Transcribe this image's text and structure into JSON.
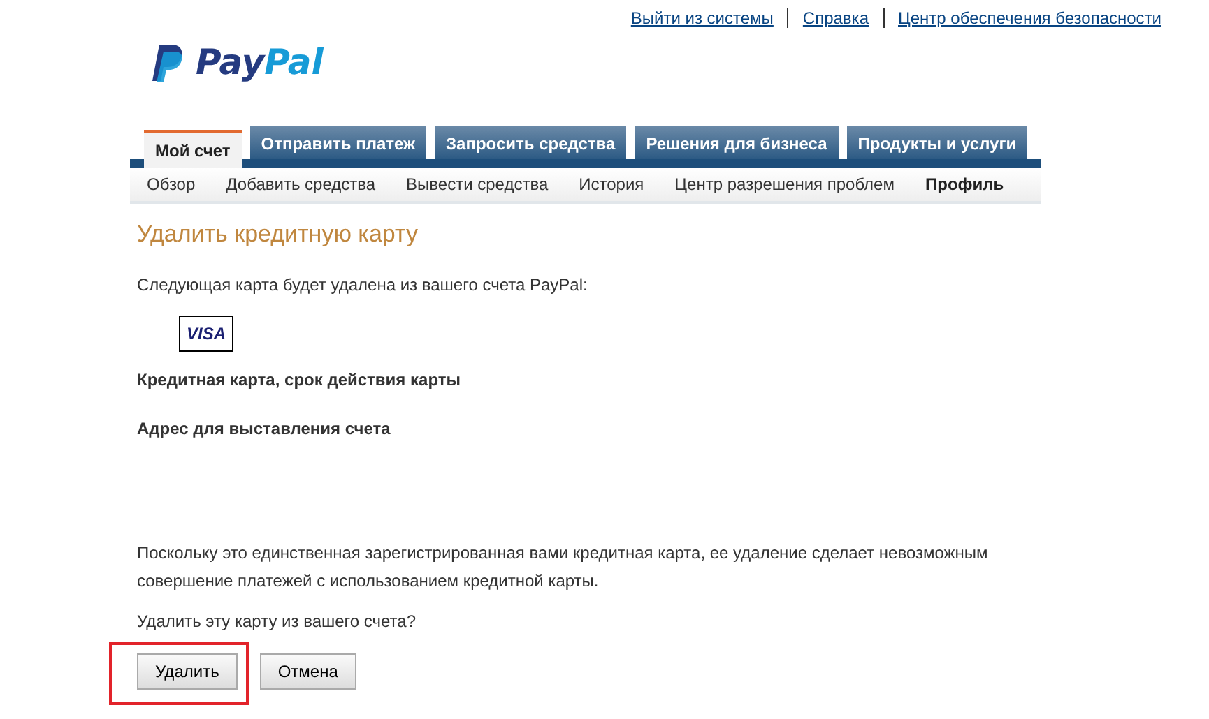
{
  "top_links": [
    {
      "label": "Выйти из системы"
    },
    {
      "label": "Справка"
    },
    {
      "label": "Центр обеспечения безопасности"
    }
  ],
  "logo": {
    "dark": "Pay",
    "light": "Pal"
  },
  "tabs": [
    {
      "label": "Мой счет",
      "selected": true
    },
    {
      "label": "Отправить платеж",
      "selected": false
    },
    {
      "label": "Запросить средства",
      "selected": false
    },
    {
      "label": "Решения для бизнеса",
      "selected": false
    },
    {
      "label": "Продукты и услуги",
      "selected": false
    }
  ],
  "subnav": [
    {
      "label": "Обзор",
      "selected": false
    },
    {
      "label": "Добавить средства",
      "selected": false
    },
    {
      "label": "Вывести средства",
      "selected": false
    },
    {
      "label": "История",
      "selected": false
    },
    {
      "label": "Центр разрешения проблем",
      "selected": false
    },
    {
      "label": "Профиль",
      "selected": true
    }
  ],
  "page_title": "Удалить кредитную карту",
  "intro": "Следующая карта будет удалена из вашего счета PayPal:",
  "card_brand": "VISA",
  "fields": [
    {
      "label": "Кредитная карта, срок действия карты"
    },
    {
      "label": "Адрес для выставления счета"
    }
  ],
  "notice": "Поскольку это единственная зарегистрированная вами кредитная карта, ее удаление сделает невозможным совершение платежей с использованием кредитной карты.",
  "question": "Удалить эту карту из вашего счета?",
  "buttons": [
    {
      "label": "Удалить",
      "highlighted": true
    },
    {
      "label": "Отмена",
      "highlighted": false
    }
  ]
}
